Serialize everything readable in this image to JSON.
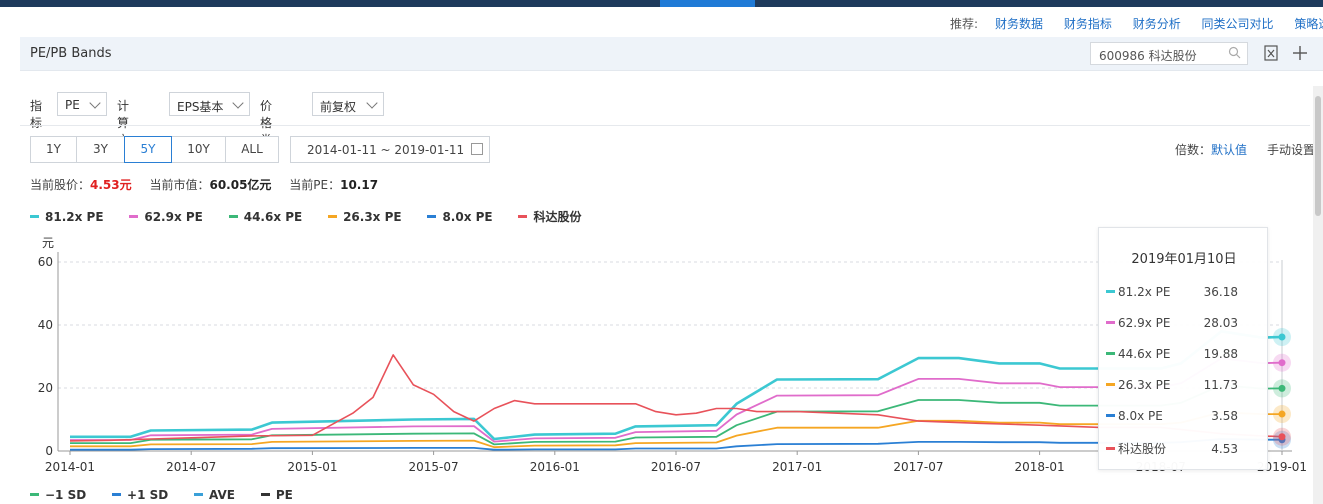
{
  "recommend": {
    "label": "推荐:",
    "links": [
      "财务数据",
      "财务指标",
      "财务分析",
      "同类公司对比",
      "策略选股"
    ]
  },
  "panel": {
    "title": "PE/PB Bands",
    "search_value": "600986 科达股份"
  },
  "filters": {
    "indicator_label": "指标",
    "indicator_value": "PE",
    "calc_label": "计算方式",
    "calc_value": "EPS基本",
    "price_label": "价格类型",
    "price_value": "前复权"
  },
  "ranges": [
    "1Y",
    "3Y",
    "5Y",
    "10Y",
    "ALL"
  ],
  "selected_range": "5Y",
  "date_range": "2014-01-11  ~  2019-01-11",
  "multiplier": {
    "label": "倍数：",
    "value": "默认值"
  },
  "manual_setting": "手动设置",
  "info": {
    "price_label": "当前股价：",
    "price_value": "4.53元",
    "mcap_label": "当前市值：",
    "mcap_value": "60.05亿元",
    "pe_label": "当前PE：",
    "pe_value": "10.17"
  },
  "colors": {
    "s812": "#3cc8d2",
    "s629": "#e06ccb",
    "s446": "#3cb878",
    "s263": "#f5a623",
    "s80": "#2a7fd4",
    "stock": "#e8525a",
    "sd_minus": "#3cb878",
    "sd_plus": "#2a7fd4",
    "ave": "#3aa0d8",
    "pe": "#333333"
  },
  "legend2": [
    "−1 SD",
    "+1 SD",
    "AVE",
    "PE"
  ],
  "tooltip": {
    "date": "2019年01月10日",
    "rows": [
      {
        "name": "81.2x PE",
        "value": "36.18",
        "color": "#3cc8d2"
      },
      {
        "name": "62.9x PE",
        "value": "28.03",
        "color": "#e06ccb"
      },
      {
        "name": "44.6x PE",
        "value": "19.88",
        "color": "#3cb878"
      },
      {
        "name": "26.3x PE",
        "value": "11.73",
        "color": "#f5a623"
      },
      {
        "name": "8.0x PE",
        "value": "3.58",
        "color": "#2a7fd4"
      },
      {
        "name": "科达股份",
        "value": "4.53",
        "color": "#e8525a"
      }
    ]
  },
  "chart_data": {
    "type": "line",
    "ylabel": "元",
    "ylim": [
      0,
      60
    ],
    "yticks": [
      0,
      20,
      40,
      60
    ],
    "xlim": [
      "2014-01",
      "2019-01"
    ],
    "xticks": [
      "2014-01",
      "2014-07",
      "2015-01",
      "2015-07",
      "2016-01",
      "2016-07",
      "2017-01",
      "2017-07",
      "2018-01",
      "2018-07",
      "2019-01"
    ],
    "grid": true,
    "legend_position": "top-left",
    "series": [
      {
        "name": "81.2x PE",
        "color": "#3cc8d2",
        "points": [
          [
            "2014-01",
            4.5
          ],
          [
            "2014-04",
            4.5
          ],
          [
            "2014-05",
            6.5
          ],
          [
            "2014-10",
            6.8
          ],
          [
            "2014-11",
            9.0
          ],
          [
            "2015-06",
            10.0
          ],
          [
            "2015-09",
            10.2
          ],
          [
            "2015-10",
            3.8
          ],
          [
            "2015-12",
            5.2
          ],
          [
            "2016-04",
            5.5
          ],
          [
            "2016-05",
            7.8
          ],
          [
            "2016-09",
            8.2
          ],
          [
            "2016-10",
            15.0
          ],
          [
            "2016-12",
            22.7
          ],
          [
            "2017-05",
            22.8
          ],
          [
            "2017-07",
            29.5
          ],
          [
            "2017-09",
            29.5
          ],
          [
            "2017-11",
            27.8
          ],
          [
            "2018-01",
            27.8
          ],
          [
            "2018-02",
            26.2
          ],
          [
            "2018-07",
            26.2
          ],
          [
            "2018-08",
            27.8
          ],
          [
            "2018-10",
            38.0
          ],
          [
            "2018-12",
            36.0
          ],
          [
            "2019-01",
            36.18
          ]
        ]
      },
      {
        "name": "62.9x PE",
        "color": "#e06ccb",
        "points": [
          [
            "2014-01",
            3.5
          ],
          [
            "2014-04",
            3.5
          ],
          [
            "2014-05",
            5.0
          ],
          [
            "2014-10",
            5.2
          ],
          [
            "2014-11",
            7.0
          ],
          [
            "2015-06",
            7.8
          ],
          [
            "2015-09",
            7.9
          ],
          [
            "2015-10",
            3.0
          ],
          [
            "2015-12",
            4.0
          ],
          [
            "2016-04",
            4.2
          ],
          [
            "2016-05",
            6.0
          ],
          [
            "2016-09",
            6.4
          ],
          [
            "2016-10",
            11.6
          ],
          [
            "2016-12",
            17.6
          ],
          [
            "2017-05",
            17.7
          ],
          [
            "2017-07",
            22.9
          ],
          [
            "2017-09",
            22.9
          ],
          [
            "2017-11",
            21.5
          ],
          [
            "2018-01",
            21.5
          ],
          [
            "2018-02",
            20.3
          ],
          [
            "2018-07",
            20.3
          ],
          [
            "2018-08",
            21.5
          ],
          [
            "2018-10",
            29.4
          ],
          [
            "2018-12",
            27.9
          ],
          [
            "2019-01",
            28.03
          ]
        ]
      },
      {
        "name": "44.6x PE",
        "color": "#3cb878",
        "points": [
          [
            "2014-01",
            2.5
          ],
          [
            "2014-04",
            2.5
          ],
          [
            "2014-05",
            3.6
          ],
          [
            "2014-10",
            3.7
          ],
          [
            "2014-11",
            5.0
          ],
          [
            "2015-06",
            5.5
          ],
          [
            "2015-09",
            5.6
          ],
          [
            "2015-10",
            2.1
          ],
          [
            "2015-12",
            2.9
          ],
          [
            "2016-04",
            3.0
          ],
          [
            "2016-05",
            4.3
          ],
          [
            "2016-09",
            4.5
          ],
          [
            "2016-10",
            8.2
          ],
          [
            "2016-12",
            12.5
          ],
          [
            "2017-05",
            12.6
          ],
          [
            "2017-07",
            16.2
          ],
          [
            "2017-09",
            16.2
          ],
          [
            "2017-11",
            15.3
          ],
          [
            "2018-01",
            15.3
          ],
          [
            "2018-02",
            14.4
          ],
          [
            "2018-07",
            14.4
          ],
          [
            "2018-08",
            15.3
          ],
          [
            "2018-10",
            20.9
          ],
          [
            "2018-12",
            19.8
          ],
          [
            "2019-01",
            19.88
          ]
        ]
      },
      {
        "name": "26.3x PE",
        "color": "#f5a623",
        "points": [
          [
            "2014-01",
            1.5
          ],
          [
            "2014-04",
            1.5
          ],
          [
            "2014-05",
            2.1
          ],
          [
            "2014-10",
            2.2
          ],
          [
            "2014-11",
            2.9
          ],
          [
            "2015-06",
            3.2
          ],
          [
            "2015-09",
            3.3
          ],
          [
            "2015-10",
            1.2
          ],
          [
            "2015-12",
            1.7
          ],
          [
            "2016-04",
            1.8
          ],
          [
            "2016-05",
            2.5
          ],
          [
            "2016-09",
            2.7
          ],
          [
            "2016-10",
            4.9
          ],
          [
            "2016-12",
            7.4
          ],
          [
            "2017-05",
            7.4
          ],
          [
            "2017-07",
            9.6
          ],
          [
            "2017-09",
            9.6
          ],
          [
            "2017-11",
            9.0
          ],
          [
            "2018-01",
            9.0
          ],
          [
            "2018-02",
            8.5
          ],
          [
            "2018-07",
            8.5
          ],
          [
            "2018-08",
            9.0
          ],
          [
            "2018-10",
            12.3
          ],
          [
            "2018-12",
            11.7
          ],
          [
            "2019-01",
            11.73
          ]
        ]
      },
      {
        "name": "8.0x PE",
        "color": "#2a7fd4",
        "points": [
          [
            "2014-01",
            0.4
          ],
          [
            "2014-04",
            0.4
          ],
          [
            "2014-05",
            0.6
          ],
          [
            "2014-10",
            0.7
          ],
          [
            "2014-11",
            0.9
          ],
          [
            "2015-06",
            1.0
          ],
          [
            "2015-09",
            1.0
          ],
          [
            "2015-10",
            0.4
          ],
          [
            "2015-12",
            0.5
          ],
          [
            "2016-04",
            0.5
          ],
          [
            "2016-05",
            0.8
          ],
          [
            "2016-09",
            0.8
          ],
          [
            "2016-10",
            1.5
          ],
          [
            "2016-12",
            2.2
          ],
          [
            "2017-05",
            2.3
          ],
          [
            "2017-07",
            2.9
          ],
          [
            "2017-09",
            2.9
          ],
          [
            "2017-11",
            2.8
          ],
          [
            "2018-01",
            2.8
          ],
          [
            "2018-02",
            2.6
          ],
          [
            "2018-07",
            2.6
          ],
          [
            "2018-08",
            2.8
          ],
          [
            "2018-10",
            3.8
          ],
          [
            "2018-12",
            3.6
          ],
          [
            "2019-01",
            3.58
          ]
        ]
      },
      {
        "name": "科达股份",
        "color": "#e8525a",
        "points": [
          [
            "2014-01",
            3.2
          ],
          [
            "2014-03",
            3.4
          ],
          [
            "2014-05",
            3.8
          ],
          [
            "2014-07",
            4.2
          ],
          [
            "2014-10",
            4.8
          ],
          [
            "2015-01",
            5.0
          ],
          [
            "2015-02",
            8.5
          ],
          [
            "2015-03",
            12.0
          ],
          [
            "2015-04",
            17.0
          ],
          [
            "2015-05",
            30.5
          ],
          [
            "2015-06",
            21.0
          ],
          [
            "2015-07",
            18.0
          ],
          [
            "2015-08",
            12.5
          ],
          [
            "2015-09",
            9.5
          ],
          [
            "2015-10",
            13.5
          ],
          [
            "2015-11",
            16.0
          ],
          [
            "2015-12",
            15.0
          ],
          [
            "2016-01",
            15.0
          ],
          [
            "2016-05",
            15.0
          ],
          [
            "2016-06",
            12.5
          ],
          [
            "2016-07",
            11.5
          ],
          [
            "2016-08",
            12.0
          ],
          [
            "2016-09",
            13.5
          ],
          [
            "2016-10",
            13.5
          ],
          [
            "2016-11",
            12.5
          ],
          [
            "2017-01",
            12.5
          ],
          [
            "2017-03",
            12.0
          ],
          [
            "2017-05",
            11.5
          ],
          [
            "2017-07",
            9.5
          ],
          [
            "2017-10",
            8.8
          ],
          [
            "2018-01",
            8.2
          ],
          [
            "2018-04",
            7.5
          ],
          [
            "2018-07",
            7.5
          ],
          [
            "2018-10",
            5.5
          ],
          [
            "2018-12",
            4.8
          ],
          [
            "2019-01",
            4.53
          ]
        ]
      }
    ]
  }
}
